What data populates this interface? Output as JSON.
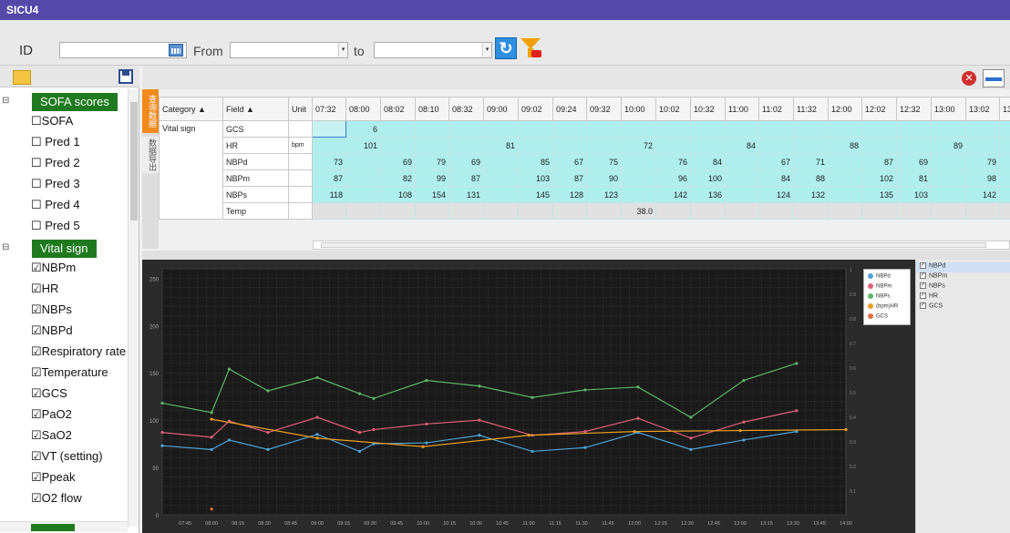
{
  "window": {
    "title": "SICU4"
  },
  "toolbar": {
    "id_label": "ID",
    "from_label": "From",
    "to_label": "to",
    "id_value": "",
    "from_value": "",
    "to_value": ""
  },
  "tree": {
    "groups": [
      {
        "label": "SOFA scores",
        "items": [
          "☐SOFA",
          "☐ Pred 1",
          "☐ Pred 2",
          "☐ Pred 3",
          "☐ Pred 4",
          "☐ Pred 5"
        ]
      },
      {
        "label": "Vital sign",
        "items": [
          "☑NBPm",
          "☑HR",
          "☑NBPs",
          "☑NBPd",
          "☑Respiratory rate",
          "☑Temperature",
          "☑GCS",
          "☑PaO2",
          "☑SaO2",
          "☑VT (setting)",
          "☑Ppeak",
          "☑O2 flow"
        ]
      }
    ]
  },
  "side_tabs": {
    "query": "查询数据",
    "export": "数据导出"
  },
  "table": {
    "headers": {
      "category": "Category",
      "field": "Field",
      "unit": "Unit"
    },
    "times": [
      "07:32",
      "08:00",
      "08:02",
      "08:10",
      "08:32",
      "09:00",
      "09:02",
      "09:24",
      "09:32",
      "10:00",
      "10:02",
      "10:32",
      "11:00",
      "11:02",
      "11:32",
      "12:00",
      "12:02",
      "12:32",
      "13:00",
      "13:02",
      "13"
    ],
    "category": "Vital sign",
    "rows": [
      {
        "field": "GCS",
        "unit": "",
        "values": [
          "",
          "6",
          "",
          "",
          "",
          "",
          "",
          "",
          "",
          "",
          "",
          "",
          "",
          "",
          "",
          "",
          "",
          "",
          "",
          "",
          ""
        ]
      },
      {
        "field": "HR",
        "unit": "bpm",
        "values": [
          "",
          "101",
          "",
          "",
          "",
          "81",
          "",
          "",
          "",
          "72",
          "",
          "",
          "84",
          "",
          "",
          "88",
          "",
          "",
          "89",
          "",
          ""
        ]
      },
      {
        "field": "NBPd",
        "unit": "",
        "values": [
          "73",
          "",
          "69",
          "79",
          "69",
          "",
          "85",
          "67",
          "75",
          "",
          "76",
          "84",
          "",
          "67",
          "71",
          "",
          "87",
          "69",
          "",
          "79",
          ""
        ]
      },
      {
        "field": "NBPm",
        "unit": "",
        "values": [
          "87",
          "",
          "82",
          "99",
          "87",
          "",
          "103",
          "87",
          "90",
          "",
          "96",
          "100",
          "",
          "84",
          "88",
          "",
          "102",
          "81",
          "",
          "98",
          ""
        ]
      },
      {
        "field": "NBPs",
        "unit": "",
        "values": [
          "118",
          "",
          "108",
          "154",
          "131",
          "",
          "145",
          "128",
          "123",
          "",
          "142",
          "136",
          "",
          "124",
          "132",
          "",
          "135",
          "103",
          "",
          "142",
          ""
        ]
      },
      {
        "field": "Temp",
        "unit": "",
        "values": [
          "",
          "",
          "",
          "",
          "",
          "",
          "",
          "",
          "",
          "38.0",
          "",
          "",
          "",
          "",
          "",
          "",
          "",
          "",
          "",
          "",
          ""
        ]
      }
    ]
  },
  "series_list": [
    "NBPd",
    "NBPm",
    "NBPs",
    "HR",
    "GCS"
  ],
  "colors": {
    "NBPd": "#4fa3d8",
    "NBPm": "#e0607a",
    "NBPs": "#5fb86a",
    "(bpm)HR": "#e8a020",
    "GCS": "#e87040"
  },
  "chart_data": {
    "type": "line",
    "x_ticks": [
      "07:45",
      "08:00",
      "08:15",
      "08:30",
      "08:45",
      "09:00",
      "09:15",
      "09:30",
      "09:45",
      "10:00",
      "10:15",
      "10:30",
      "10:45",
      "11:00",
      "11:15",
      "11:30",
      "11:45",
      "12:00",
      "12:15",
      "12:30",
      "12:45",
      "13:00",
      "13:15",
      "13:30",
      "13:45",
      "14:00"
    ],
    "y_left_ticks": [
      "0",
      "50",
      "100",
      "150",
      "200",
      "250"
    ],
    "y_right_ticks": [
      "0.1",
      "0.2",
      "0.3",
      "0.4",
      "0.5",
      "0.6",
      "0.7",
      "0.8",
      "0.9",
      "1"
    ],
    "ylim": [
      0,
      260
    ],
    "xlim": [
      "07:32",
      "14:00"
    ],
    "legend": [
      "NBPd",
      "NBPm",
      "NBPs",
      "(bpm)HR",
      "GCS"
    ],
    "legend_position": "top-right",
    "series": [
      {
        "name": "NBPd",
        "x": [
          "07:32",
          "08:00",
          "08:10",
          "08:32",
          "09:00",
          "09:24",
          "09:32",
          "10:02",
          "10:32",
          "11:02",
          "11:32",
          "12:02",
          "12:32",
          "13:02",
          "13:32"
        ],
        "values": [
          73,
          69,
          79,
          69,
          85,
          67,
          75,
          76,
          84,
          67,
          71,
          87,
          69,
          79,
          88
        ]
      },
      {
        "name": "NBPm",
        "x": [
          "07:32",
          "08:00",
          "08:10",
          "08:32",
          "09:00",
          "09:24",
          "09:32",
          "10:02",
          "10:32",
          "11:02",
          "11:32",
          "12:02",
          "12:32",
          "13:02",
          "13:32"
        ],
        "values": [
          87,
          82,
          99,
          87,
          103,
          87,
          90,
          96,
          100,
          84,
          88,
          102,
          81,
          98,
          110
        ]
      },
      {
        "name": "NBPs",
        "x": [
          "07:32",
          "08:00",
          "08:10",
          "08:32",
          "09:00",
          "09:24",
          "09:32",
          "10:02",
          "10:32",
          "11:02",
          "11:32",
          "12:02",
          "12:32",
          "13:02",
          "13:32"
        ],
        "values": [
          118,
          108,
          154,
          131,
          145,
          128,
          123,
          142,
          136,
          124,
          132,
          135,
          103,
          142,
          160
        ]
      },
      {
        "name": "(bpm)HR",
        "x": [
          "08:00",
          "09:00",
          "10:00",
          "11:00",
          "12:00",
          "13:00",
          "14:00"
        ],
        "values": [
          101,
          81,
          72,
          84,
          88,
          89,
          90
        ]
      },
      {
        "name": "GCS",
        "x": [
          "08:00"
        ],
        "values": [
          6
        ]
      }
    ]
  }
}
